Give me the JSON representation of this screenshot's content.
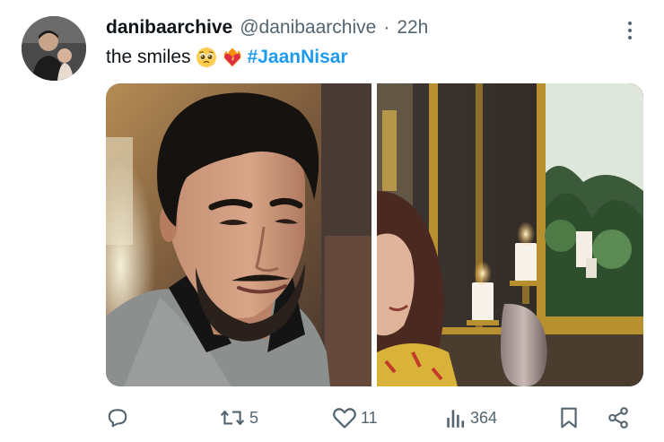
{
  "tweet": {
    "display_name": "danibaarchive",
    "handle": "@danibaarchive",
    "separator": "·",
    "timestamp": "22h",
    "text": "the smiles",
    "emojis": [
      "pleading-face",
      "heart-on-fire"
    ],
    "hashtag": "#JaanNisar"
  },
  "media": [
    {
      "icon": "photo-man-smiling"
    },
    {
      "icon": "photo-woman-candles"
    }
  ],
  "actions": {
    "replies": "",
    "retweets": "5",
    "likes": "11",
    "views": "364"
  },
  "colors": {
    "accent": "#1d9bf0",
    "secondary_text": "#536471",
    "primary_text": "#0f1419"
  }
}
